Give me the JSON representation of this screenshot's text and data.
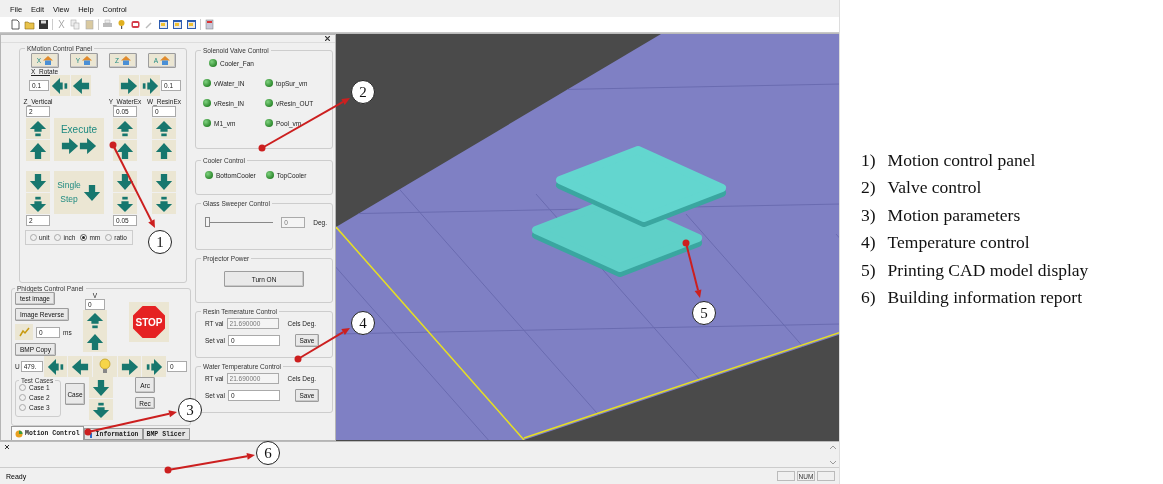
{
  "menu": [
    "File",
    "Edit",
    "View",
    "Help",
    "Control"
  ],
  "kmotion": {
    "title": "KMotion Control Panel",
    "home_buttons": [
      "X",
      "Y",
      "Z",
      "A"
    ],
    "x_rotate": {
      "label": "X_Rotate",
      "left_value": "0.1",
      "right_value": "0.1"
    },
    "axes": [
      {
        "label": "Z_Vertical",
        "value": "2",
        "bottom_value": "2"
      },
      {
        "label": "Y_WaterEx",
        "value": "0.05",
        "bottom_value": "0.05"
      },
      {
        "label": "W_ResinEx",
        "value": "0"
      }
    ],
    "execute": "Execute",
    "single_step": "Single Step",
    "units": [
      {
        "label": "unit",
        "selected": false
      },
      {
        "label": "inch",
        "selected": false
      },
      {
        "label": "mm",
        "selected": true
      },
      {
        "label": "ratio",
        "selected": false
      }
    ]
  },
  "phidgets": {
    "title": "Phidgets Control Panel",
    "test_image": "test image",
    "image_reverse": "Image Reverse",
    "bmp_copy": "BMP Copy",
    "ms_value": "0",
    "ms_unit": "ms",
    "v_label": "V",
    "v_value": "0",
    "u_label": "U",
    "u_value": "479.",
    "h_value": "0",
    "stop": "STOP",
    "test_cases": {
      "title": "Test Cases",
      "cases": [
        {
          "label": "Case 1",
          "selected": false
        },
        {
          "label": "Case 2",
          "selected": false
        },
        {
          "label": "Case 3",
          "selected": false
        }
      ]
    },
    "case_button": "Case",
    "arc_button": "Arc",
    "rec_button": "Rec"
  },
  "solenoid": {
    "title": "Solenoid Valve Control",
    "valves": [
      {
        "label": "Cooler_Fan",
        "on": true
      },
      {
        "label": "vWater_IN",
        "on": true
      },
      {
        "label": "topSur_vm",
        "on": true
      },
      {
        "label": "vResin_IN",
        "on": true
      },
      {
        "label": "vResin_OUT",
        "on": true
      },
      {
        "label": "M1_vm",
        "on": true
      },
      {
        "label": "Pool_vm",
        "on": true
      }
    ]
  },
  "cooler": {
    "title": "Cooler Control",
    "items": [
      {
        "label": "BottomCooler",
        "on": true
      },
      {
        "label": "TopCooler",
        "on": true
      }
    ]
  },
  "sweeper": {
    "title": "Glass Sweeper Control",
    "level": 0,
    "value": "0",
    "unit": "Deg."
  },
  "projector": {
    "title": "Projector Power",
    "button": "Turn ON"
  },
  "temperatures": [
    {
      "title": "Resin Temerature Control",
      "rt_label": "RT val",
      "rt_value": "21.690000",
      "unit": "Cels Deg.",
      "set_label": "Set val",
      "set_value": "0",
      "button": "Save"
    },
    {
      "title": "Water Temperature Control",
      "rt_label": "RT val",
      "rt_value": "21.690000",
      "unit": "Cels Deg.",
      "set_label": "Set val",
      "set_value": "0",
      "button": "Save"
    }
  ],
  "tabs": [
    {
      "label": "Motion Control",
      "selected": true
    },
    {
      "label": "Information",
      "selected": false
    },
    {
      "label": "BMP Slicer",
      "selected": false
    }
  ],
  "status_bar": {
    "text": "Ready",
    "indicator": "NUM"
  },
  "callouts": [
    "1",
    "2",
    "3",
    "4",
    "5",
    "6"
  ],
  "legend": [
    {
      "number": "1)",
      "text": "Motion control panel"
    },
    {
      "number": "2)",
      "text": "Valve control"
    },
    {
      "number": "3)",
      "text": "Motion parameters"
    },
    {
      "number": "4)",
      "text": "Temperature control"
    },
    {
      "number": "5)",
      "text": "Printing CAD model display"
    },
    {
      "number": "6)",
      "text": "Building information report"
    }
  ]
}
